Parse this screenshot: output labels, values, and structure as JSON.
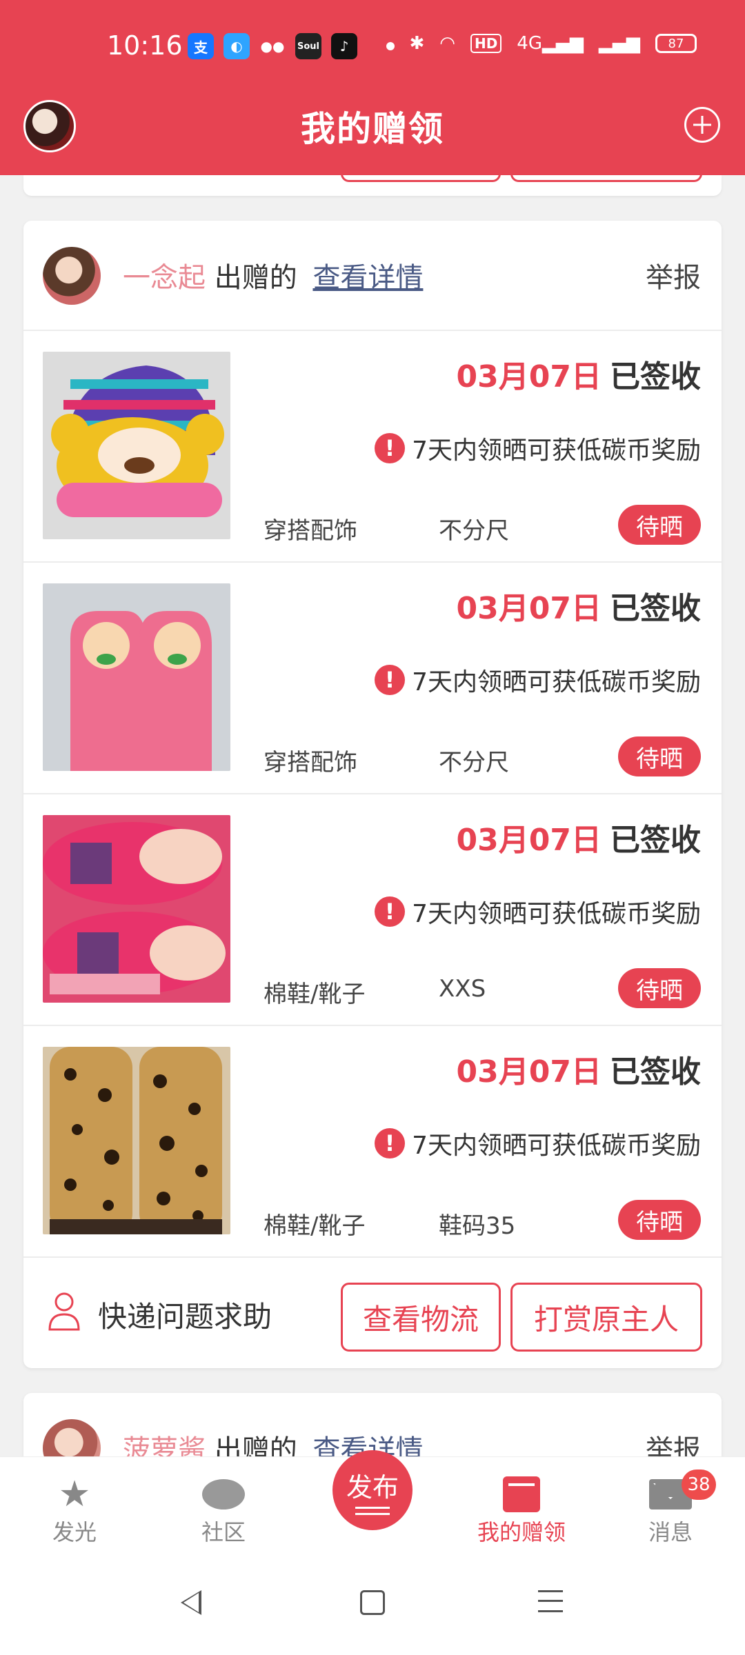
{
  "status_bar": {
    "time": "10:16",
    "battery": "87",
    "network": "4G",
    "hd": "HD",
    "app_icons": [
      "alipay",
      "browser",
      "wechat",
      "soul",
      "tiktok"
    ]
  },
  "header": {
    "title": "我的赠领",
    "add_icon": "plus-circle-icon"
  },
  "card": {
    "giver_name": "一念起",
    "gave_text": "出赠的",
    "detail_link": "查看详情",
    "report": "举报",
    "items": [
      {
        "date": "03月07日",
        "status": "已签收",
        "notice": "7天内领晒可获低碳币奖励",
        "category": "穿搭配饰",
        "size": "不分尺",
        "tag": "待晒"
      },
      {
        "date": "03月07日",
        "status": "已签收",
        "notice": "7天内领晒可获低碳币奖励",
        "category": "穿搭配饰",
        "size": "不分尺",
        "tag": "待晒"
      },
      {
        "date": "03月07日",
        "status": "已签收",
        "notice": "7天内领晒可获低碳币奖励",
        "category": "棉鞋/靴子",
        "size": "XXS",
        "tag": "待晒"
      },
      {
        "date": "03月07日",
        "status": "已签收",
        "notice": "7天内领晒可获低碳币奖励",
        "category": "棉鞋/靴子",
        "size": "鞋码35",
        "tag": "待晒"
      }
    ],
    "help_text": "快递问题求助",
    "btn_logistics": "查看物流",
    "btn_reward": "打赏原主人"
  },
  "card2": {
    "giver_name": "菠萝酱",
    "gave_text": "出赠的",
    "detail_link": "查看详情",
    "report": "举报"
  },
  "tabbar": {
    "faguang": "发光",
    "shequ": "社区",
    "publish": "发布",
    "mine": "我的赠领",
    "msg": "消息",
    "msg_badge": "38"
  },
  "colors": {
    "brand": "#e74352",
    "giver_name": "#e98a94",
    "link": "#4a5a85"
  }
}
